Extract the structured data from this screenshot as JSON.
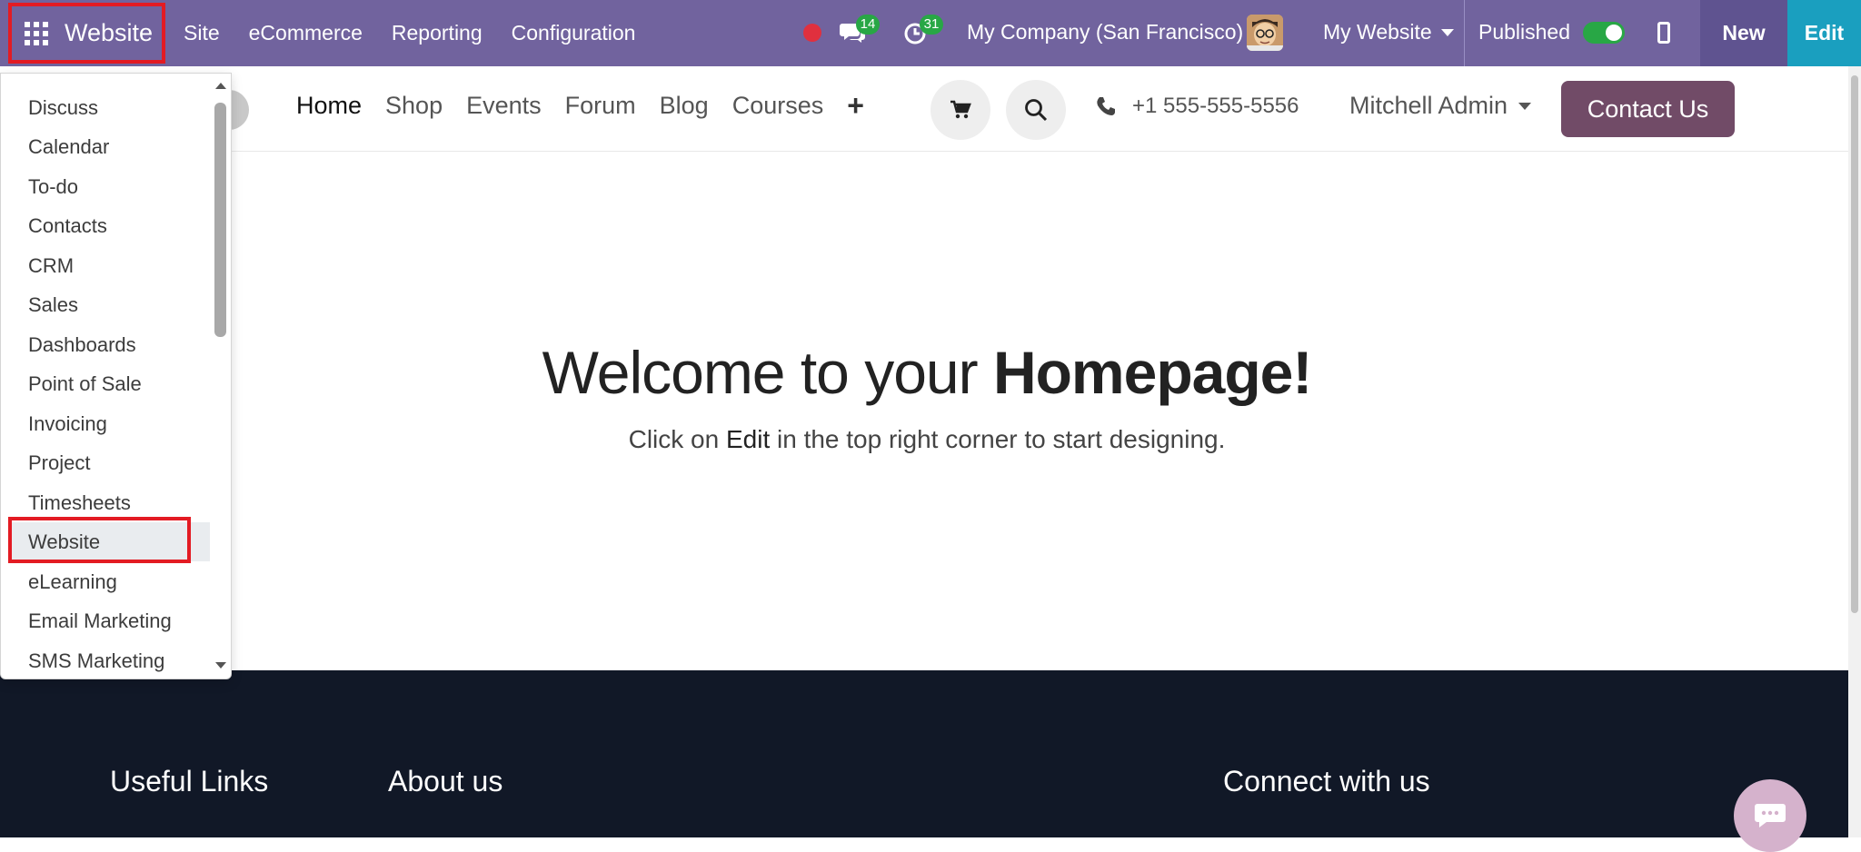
{
  "navbar": {
    "app_title": "Website",
    "menu": [
      "Site",
      "eCommerce",
      "Reporting",
      "Configuration"
    ],
    "messages_count": "14",
    "activities_count": "31",
    "company": "My Company (San Francisco)",
    "website_selector": "My Website",
    "published_label": "Published",
    "published": true,
    "new_label": "New",
    "edit_label": "Edit",
    "colors": {
      "bar": "#71639e",
      "edit": "#1a9fbf",
      "highlight": "#e31b23",
      "badge": "#28a745"
    }
  },
  "apps_menu": {
    "items": [
      "Discuss",
      "Calendar",
      "To-do",
      "Contacts",
      "CRM",
      "Sales",
      "Dashboards",
      "Point of Sale",
      "Invoicing",
      "Project",
      "Timesheets",
      "Website",
      "eLearning",
      "Email Marketing",
      "SMS Marketing"
    ],
    "selected": "Website"
  },
  "site_header": {
    "nav": [
      "Home",
      "Shop",
      "Events",
      "Forum",
      "Blog",
      "Courses"
    ],
    "active": "Home",
    "phone": "+1 555-555-5556",
    "user": "Mitchell Admin",
    "contact_button": "Contact Us",
    "cart_icon": "cart-icon",
    "search_icon": "search-icon"
  },
  "hero": {
    "title_prefix": "Welcome to your ",
    "title_bold": "Homepage!",
    "subtitle_before": "Click on ",
    "subtitle_em": "Edit",
    "subtitle_after": " in the top right corner to start designing."
  },
  "footer": {
    "useful_links_heading": "Useful Links",
    "about_heading": "About us",
    "connect_heading": "Connect with us"
  }
}
